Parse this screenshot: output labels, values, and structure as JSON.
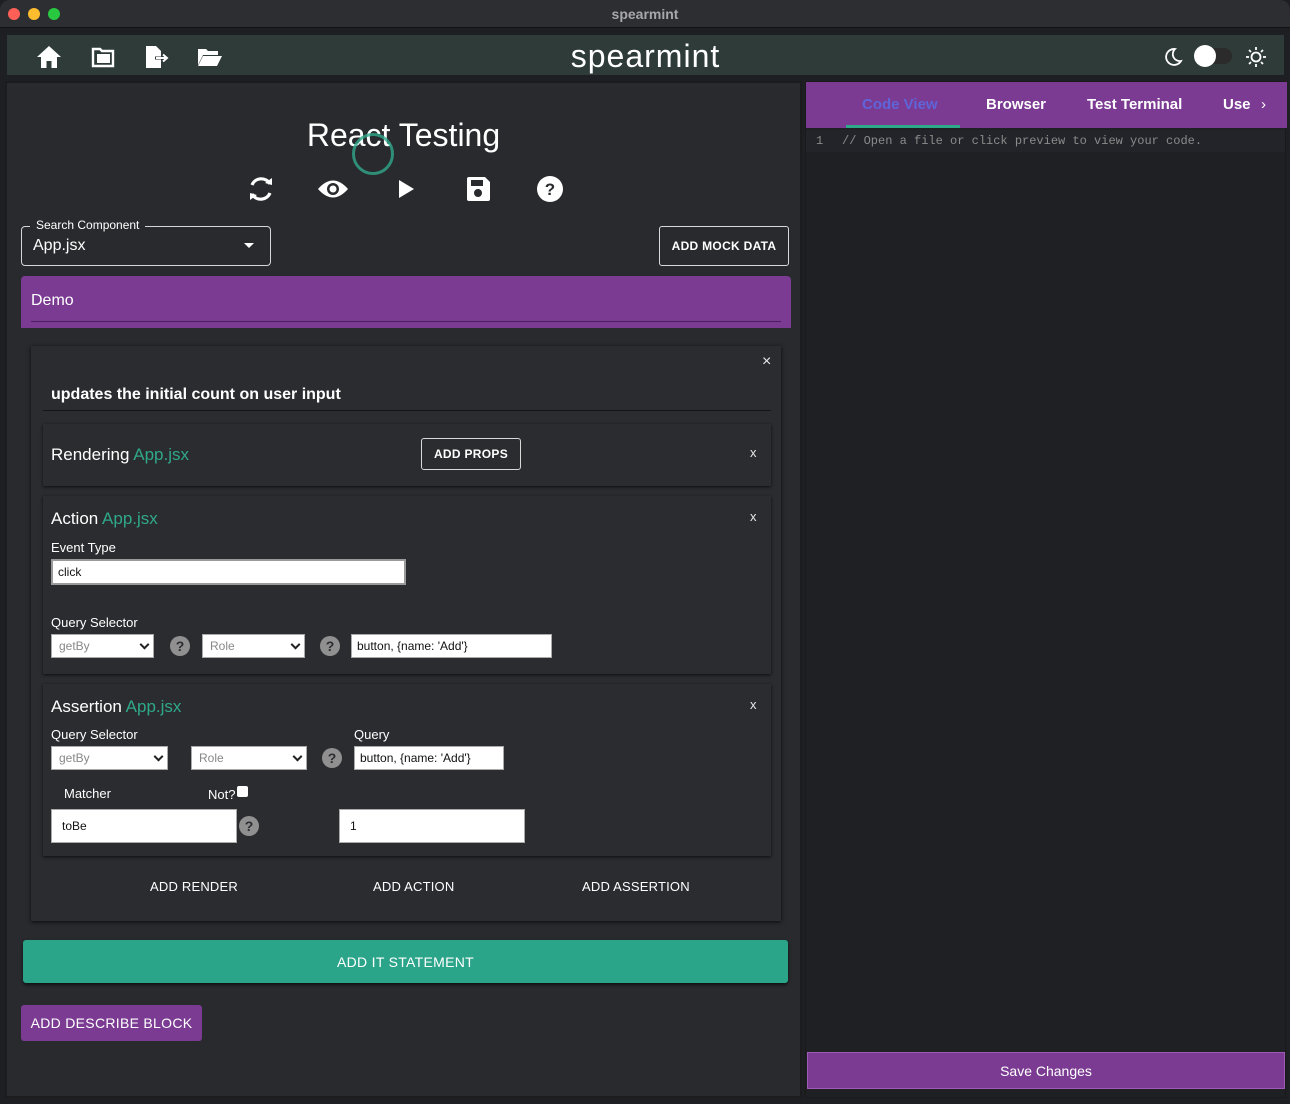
{
  "window": {
    "title": "spearmint"
  },
  "header": {
    "brand": "spearmint",
    "icons": [
      "home-icon",
      "new-folder-icon",
      "export-file-icon",
      "open-folder-icon"
    ],
    "theme_toggle": {
      "left_icon": "moon-icon",
      "right_icon": "sun-icon",
      "state": "off"
    }
  },
  "main": {
    "title": "React Testing",
    "toolbar_icons": [
      "refresh-icon",
      "eye-icon",
      "play-icon",
      "save-icon",
      "help-icon"
    ],
    "search": {
      "label": "Search Component",
      "value": "App.jsx"
    },
    "add_mock_data": "ADD MOCK DATA",
    "describe": {
      "label": "Demo"
    },
    "it_block": {
      "text": "updates the initial count on user input",
      "close": "×",
      "rendering": {
        "title": "Rendering",
        "component": "App.jsx",
        "add_props": "ADD PROPS",
        "close": "x"
      },
      "action": {
        "title": "Action",
        "component": "App.jsx",
        "close": "x",
        "event_type_label": "Event Type",
        "event_type_value": "click",
        "query_selector_label": "Query Selector",
        "query_variant": "getBy",
        "query_type": "Role",
        "query_value": "button, {name: 'Add'}"
      },
      "assertion": {
        "title": "Assertion",
        "component": "App.jsx",
        "close": "x",
        "query_selector_label": "Query Selector",
        "query_label": "Query",
        "query_variant": "getBy",
        "query_type": "Role",
        "query_value": "button, {name: 'Add'}",
        "matcher_label": "Matcher",
        "not_label": "Not?",
        "matcher_value": "toBe",
        "expected_value": "1"
      },
      "add_render": "ADD RENDER",
      "add_action": "ADD ACTION",
      "add_assertion": "ADD ASSERTION"
    },
    "add_it_statement": "ADD IT STATEMENT",
    "add_describe_block": "ADD DESCRIBE BLOCK"
  },
  "right_panel": {
    "tabs": [
      "Code View",
      "Browser",
      "Test Terminal",
      "Use"
    ],
    "active_tab": "Code View",
    "code": {
      "line_number": "1",
      "text": "// Open a file or click preview to view your code."
    },
    "save_changes": "Save Changes"
  },
  "colors": {
    "accent_purple": "#7b3b92",
    "accent_teal": "#2ba58a",
    "header_bg": "#2e3b38",
    "panel_bg": "#282a2e"
  }
}
